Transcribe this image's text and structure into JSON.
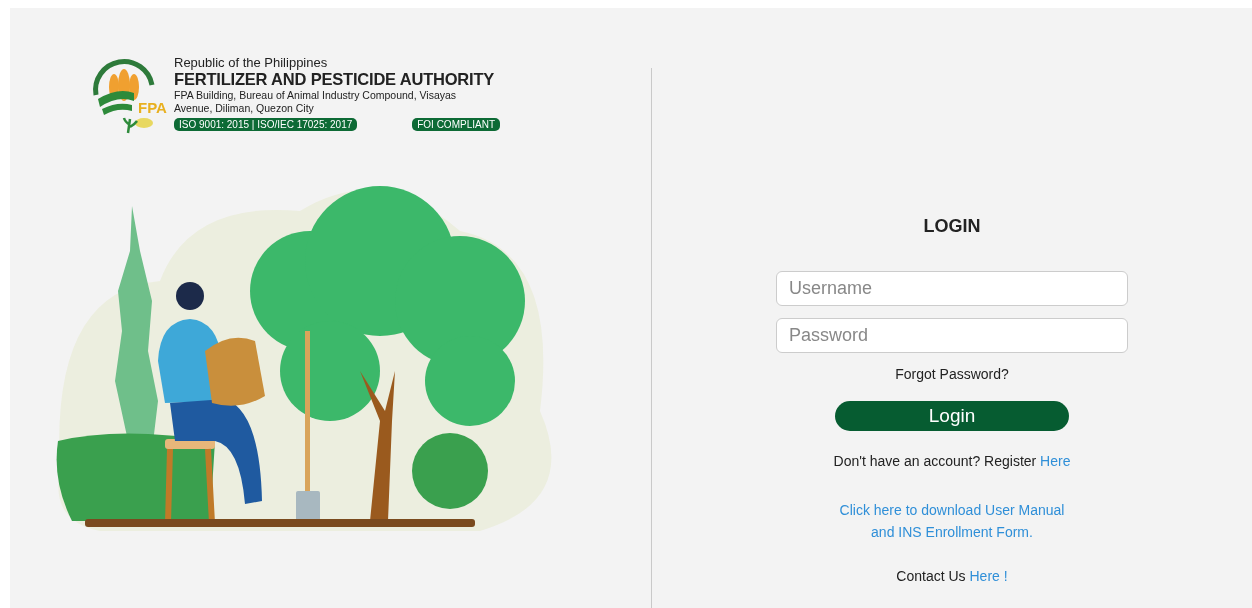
{
  "header": {
    "logo_text": "FPA",
    "line_1": "Republic of the Philippines",
    "title": "FERTILIZER AND PESTICIDE AUTHORITY",
    "address": "FPA Building, Bureau of Animal Industry Compound, Visayas Avenue, Diliman, Quezon City",
    "badges": [
      "ISO 9001: 2015 | ISO/IEC 17025: 2017",
      "FOI COMPLIANT"
    ]
  },
  "login": {
    "title": "LOGIN",
    "fields": [
      {
        "placeholder": "Username"
      },
      {
        "placeholder": "Password"
      }
    ],
    "forgot_link": "Forgot Password?",
    "button": "Login",
    "register": {
      "text": "Don't have an account? Register",
      "link": "Here"
    },
    "download_link": "Click here to download User Manual and INS Enrollment Form.",
    "contact": {
      "text": "Contact Us",
      "link": "Here !"
    }
  }
}
